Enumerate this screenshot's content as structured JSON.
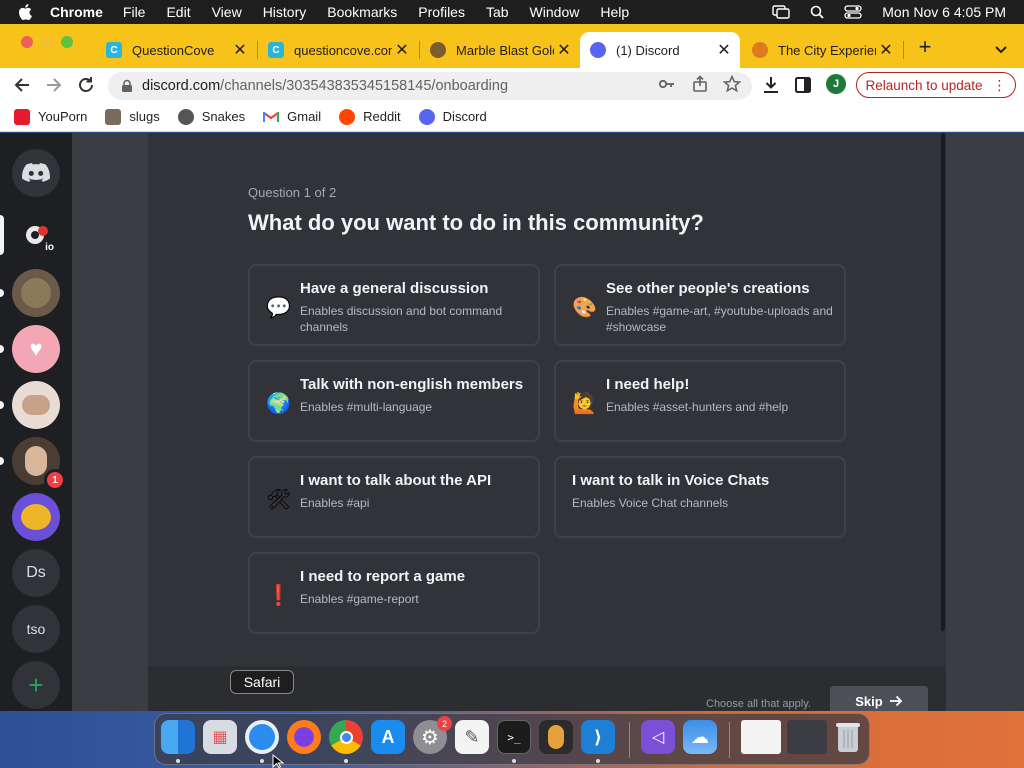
{
  "menubar": {
    "app_name": "Chrome",
    "menus": [
      "File",
      "Edit",
      "View",
      "History",
      "Bookmarks",
      "Profiles",
      "Tab",
      "Window",
      "Help"
    ],
    "clock": "Mon Nov 6  4:05 PM"
  },
  "tabs": [
    {
      "title": "QuestionCove",
      "favicon": "questioncove-icon",
      "color": "#2bb5d8"
    },
    {
      "title": "questioncove.com",
      "favicon": "questioncove-icon",
      "color": "#2bb5d8"
    },
    {
      "title": "Marble Blast Gold",
      "favicon": "marble-icon",
      "color": "#7a5c2e"
    },
    {
      "title": "(1) Discord",
      "favicon": "discord-icon",
      "color": "#5865f2",
      "active": true
    },
    {
      "title": "The City Experience",
      "favicon": "city-icon",
      "color": "#e07a1f"
    }
  ],
  "toolbar": {
    "url_host": "discord.com",
    "url_path": "/channels/303543835345158145/onboarding",
    "profile_initial": "J",
    "relaunch_label": "Relaunch to update"
  },
  "bookmarks": [
    {
      "label": "YouPorn",
      "icon": "youporn-icon",
      "color": "#e8192c"
    },
    {
      "label": "slugs",
      "icon": "slugs-icon",
      "color": "#7b6a5a"
    },
    {
      "label": "Snakes",
      "icon": "globe-icon",
      "color": "#555555"
    },
    {
      "label": "Gmail",
      "icon": "gmail-icon",
      "color": "#ea4335"
    },
    {
      "label": "Reddit",
      "icon": "reddit-icon",
      "color": "#ff4500"
    },
    {
      "label": "Discord",
      "icon": "discord-icon",
      "color": "#5865f2"
    }
  ],
  "servers": {
    "server_io_label": "io",
    "badge_count": "1",
    "ds_label": "Ds",
    "tso_label": "tso"
  },
  "onboarding": {
    "question_count": "Question 1 of 2",
    "question_title": "What do you want to do in this community?",
    "options": [
      {
        "emoji": "💬",
        "icon": "speech-bubble-icon",
        "name": "Have a general discussion",
        "desc": "Enables discussion and bot command channels"
      },
      {
        "emoji": "🎨",
        "icon": "palette-icon",
        "name": "See other people's creations",
        "desc": "Enables #game-art, #youtube-uploads and #showcase"
      },
      {
        "emoji": "🌍",
        "icon": "globe-icon",
        "name": "Talk with non-english members",
        "desc": "Enables #multi-language"
      },
      {
        "emoji": "🙋",
        "icon": "person-raising-hand-icon",
        "name": "I need help!",
        "desc": "Enables #asset-hunters and #help"
      },
      {
        "emoji": "🛠",
        "icon": "tools-icon",
        "name": "I want to talk about the API",
        "desc": "Enables #api"
      },
      {
        "emoji": "",
        "icon": "",
        "name": "I want to talk in Voice Chats",
        "desc": "Enables Voice Chat channels"
      },
      {
        "emoji": "❗",
        "icon": "exclamation-icon",
        "name": "I need to report a game",
        "desc": "Enables #game-report"
      }
    ],
    "footer_hint": "Choose all that apply.",
    "skip_label": "Skip"
  },
  "dock": {
    "tooltip": "Safari",
    "settings_badge": "2",
    "apps": [
      "Finder",
      "Launchpad",
      "Safari",
      "Firefox",
      "Chrome",
      "App Store",
      "System Settings",
      "TextEdit",
      "Terminal",
      "GarageBand",
      "Visual Studio Code",
      "Visual Studio",
      "Weather",
      "Window Preview 1",
      "Window Preview 2",
      "Trash"
    ]
  }
}
